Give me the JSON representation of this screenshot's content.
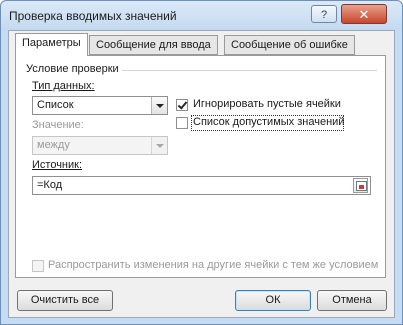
{
  "window": {
    "title": "Проверка вводимых значений",
    "help_label": "?",
    "close_label": "✕"
  },
  "tabs": [
    {
      "label": "Параметры",
      "active": true
    },
    {
      "label": "Сообщение для ввода",
      "active": false
    },
    {
      "label": "Сообщение об ошибке",
      "active": false
    }
  ],
  "validation": {
    "group_title": "Условие проверки",
    "data_type_label": "Тип данных:",
    "data_type_value": "Список",
    "value_label": "Значение:",
    "value_value": "между",
    "ignore_blank_label": "Игнорировать пустые ячейки",
    "ignore_blank_checked": true,
    "in_cell_dropdown_label": "Список допустимых значений",
    "in_cell_dropdown_checked": false,
    "source_label": "Источник:",
    "source_value": "=Код",
    "apply_all_label": "Распространить изменения на другие ячейки с тем же условием",
    "apply_all_checked": false
  },
  "buttons": {
    "clear_all": "Очистить все",
    "ok": "ОК",
    "cancel": "Отмена"
  }
}
